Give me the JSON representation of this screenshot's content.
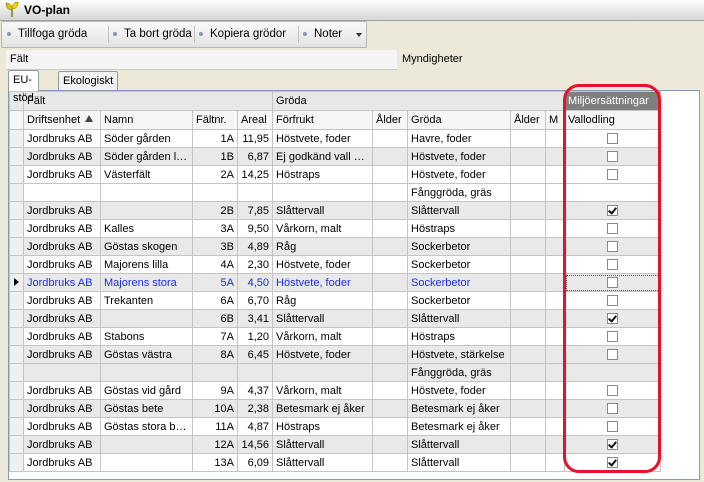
{
  "window": {
    "title": "VO-plan"
  },
  "toolbar": {
    "add_label": "Tillfoga gröda",
    "remove_label": "Ta bort gröda",
    "copy_label": "Kopiera grödor",
    "notes_label": "Noter"
  },
  "panes": {
    "falt": "Fält",
    "myndigheter": "Myndigheter"
  },
  "tabs": {
    "eu": "EU-stöd",
    "eko": "Ekologiskt"
  },
  "grid": {
    "bands": {
      "falt": "Fält",
      "groda": "Gröda",
      "miljo": "Miljöersättningar"
    },
    "headers": {
      "driftsenhet": "Driftsenhet",
      "namn": "Namn",
      "faltnr": "Fältnr.",
      "areal": "Areal",
      "forfrukt": "Förfrukt",
      "alder1": "Ålder",
      "groda": "Gröda",
      "alder2": "Ålder",
      "m": "M",
      "vallodling": "Vallodling"
    },
    "rows": [
      {
        "driftsenhet": "Jordbruks AB",
        "namn": "Söder gården",
        "faltnr": "1A",
        "areal": "11,95",
        "forfrukt": "Höstvete, foder",
        "groda": "Havre, foder",
        "vallodling": false
      },
      {
        "driftsenhet": "Jordbruks AB",
        "namn": "Söder gården lilla",
        "faltnr": "1B",
        "areal": "6,87",
        "forfrukt": "Ej godkänd vall åker",
        "groda": "Höstvete, foder",
        "vallodling": false
      },
      {
        "driftsenhet": "Jordbruks AB",
        "namn": "Västerfält",
        "faltnr": "2A",
        "areal": "14,25",
        "forfrukt": "Höstraps",
        "groda": "Höstvete, foder",
        "groda2": "Fånggröda, gräs",
        "vallodling": false
      },
      {
        "driftsenhet": "Jordbruks AB",
        "namn": "",
        "faltnr": "2B",
        "areal": "7,85",
        "forfrukt": "Slåttervall",
        "groda": "Slåttervall",
        "vallodling": true
      },
      {
        "driftsenhet": "Jordbruks AB",
        "namn": "Kalles",
        "faltnr": "3A",
        "areal": "9,50",
        "forfrukt": "Vårkorn, malt",
        "groda": "Höstraps",
        "vallodling": false
      },
      {
        "driftsenhet": "Jordbruks AB",
        "namn": "Göstas skogen",
        "faltnr": "3B",
        "areal": "4,89",
        "forfrukt": "Råg",
        "groda": "Sockerbetor",
        "vallodling": false
      },
      {
        "driftsenhet": "Jordbruks AB",
        "namn": "Majorens lilla",
        "faltnr": "4A",
        "areal": "2,30",
        "forfrukt": "Höstvete, foder",
        "groda": "Sockerbetor",
        "vallodling": false
      },
      {
        "driftsenhet": "Jordbruks AB",
        "namn": "Majorens stora",
        "faltnr": "5A",
        "areal": "4,50",
        "forfrukt": "Höstvete, foder",
        "groda": "Sockerbetor",
        "vallodling": false,
        "current": true
      },
      {
        "driftsenhet": "Jordbruks AB",
        "namn": "Trekanten",
        "faltnr": "6A",
        "areal": "6,70",
        "forfrukt": "Råg",
        "groda": "Sockerbetor",
        "vallodling": false
      },
      {
        "driftsenhet": "Jordbruks AB",
        "namn": "",
        "faltnr": "6B",
        "areal": "3,41",
        "forfrukt": "Slåttervall",
        "groda": "Slåttervall",
        "vallodling": true
      },
      {
        "driftsenhet": "Jordbruks AB",
        "namn": "Stabons",
        "faltnr": "7A",
        "areal": "1,20",
        "forfrukt": "Vårkorn, malt",
        "groda": "Höstraps",
        "vallodling": false
      },
      {
        "driftsenhet": "Jordbruks AB",
        "namn": "Göstas västra",
        "faltnr": "8A",
        "areal": "6,45",
        "forfrukt": "Höstvete, foder",
        "groda": "Höstvete, stärkelse",
        "groda2": "Fånggröda, gräs",
        "vallodling": false
      },
      {
        "driftsenhet": "Jordbruks AB",
        "namn": "Göstas vid gård",
        "faltnr": "9A",
        "areal": "4,37",
        "forfrukt": "Vårkorn, malt",
        "groda": "Höstvete, foder",
        "vallodling": false
      },
      {
        "driftsenhet": "Jordbruks AB",
        "namn": "Göstas bete",
        "faltnr": "10A",
        "areal": "2,38",
        "forfrukt": "Betesmark ej åker",
        "groda": "Betesmark ej åker",
        "vallodling": false
      },
      {
        "driftsenhet": "Jordbruks AB",
        "namn": "Göstas stora bete",
        "faltnr": "11A",
        "areal": "4,87",
        "forfrukt": "Höstraps",
        "groda": "Betesmark ej åker",
        "vallodling": false
      },
      {
        "driftsenhet": "Jordbruks AB",
        "namn": "",
        "faltnr": "12A",
        "areal": "14,56",
        "forfrukt": "Slåttervall",
        "groda": "Slåttervall",
        "vallodling": true
      },
      {
        "driftsenhet": "Jordbruks AB",
        "namn": "",
        "faltnr": "13A",
        "areal": "6,09",
        "forfrukt": "Slåttervall",
        "groda": "Slåttervall",
        "vallodling": true
      }
    ]
  },
  "colors": {
    "highlight": "#e8102a",
    "current_row_text": "#1c2ed6",
    "band_dark": "#7f7f7f"
  }
}
